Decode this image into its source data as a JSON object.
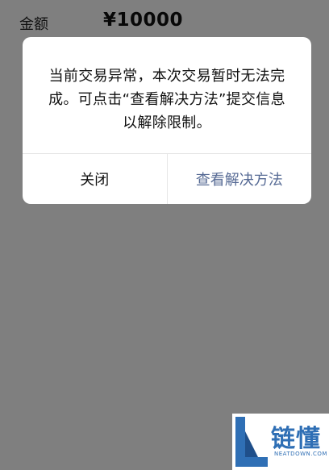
{
  "page": {
    "amount_label": "金额",
    "amount_value": "¥10000"
  },
  "dialog": {
    "message": "当前交易异常，本次交易暂时无法完成。可点击“查看解决方法”提交信息以解除限制。",
    "close_label": "关闭",
    "solution_label": "查看解决方法"
  },
  "watermark": {
    "title": "链懂",
    "subtitle": "NEATDOWN.COM"
  },
  "colors": {
    "overlay": "#808080",
    "link_blue": "#576b95",
    "brand_blue": "#2f6fb5"
  }
}
